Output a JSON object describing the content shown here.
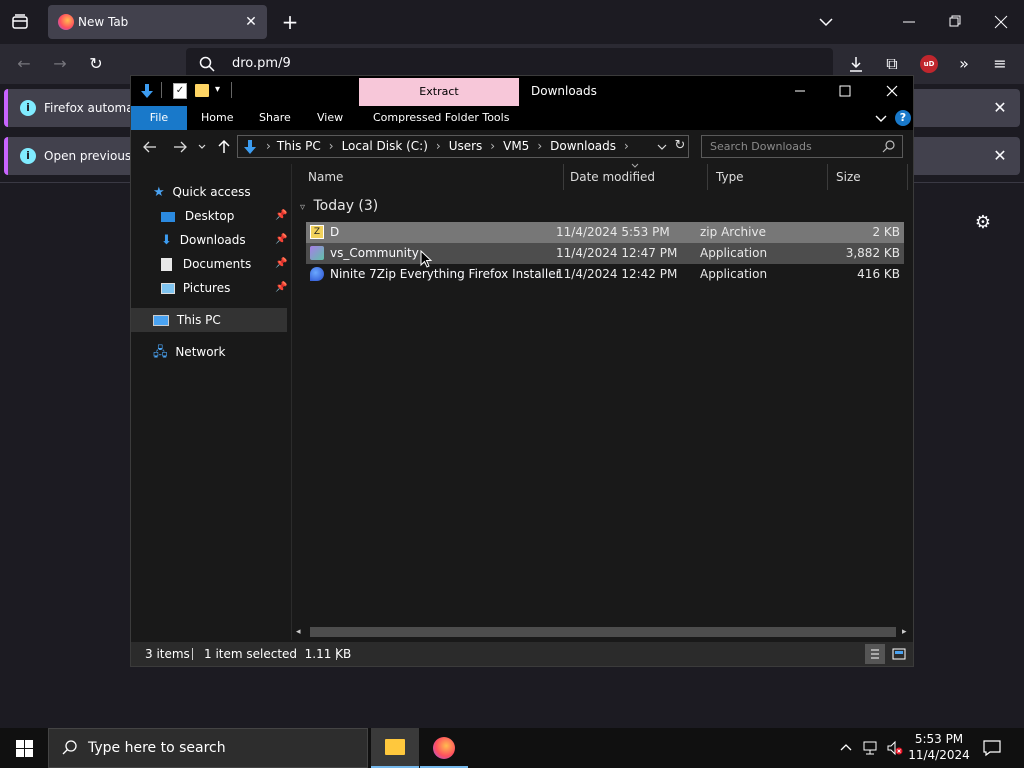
{
  "browser": {
    "tab_title": "New Tab",
    "url": "dro.pm/9",
    "notification_1": "Firefox automatic",
    "notification_2": "Open previous ta"
  },
  "explorer": {
    "window_title": "Downloads",
    "context_tab_header": "Extract",
    "ribbon_tabs": [
      "File",
      "Home",
      "Share",
      "View",
      "Compressed Folder Tools"
    ],
    "breadcrumb": [
      "This PC",
      "Local Disk (C:)",
      "Users",
      "VM5",
      "Downloads"
    ],
    "search_placeholder": "Search Downloads",
    "nav": {
      "quick_access": "Quick access",
      "desktop": "Desktop",
      "downloads": "Downloads",
      "documents": "Documents",
      "pictures": "Pictures",
      "this_pc": "This PC",
      "network": "Network"
    },
    "columns": {
      "name": "Name",
      "date": "Date modified",
      "type": "Type",
      "size": "Size"
    },
    "group_label": "Today (3)",
    "files": [
      {
        "name": "D",
        "date": "11/4/2024 5:53 PM",
        "type": "zip Archive",
        "size": "2 KB"
      },
      {
        "name": "vs_Community",
        "date": "11/4/2024 12:47 PM",
        "type": "Application",
        "size": "3,882 KB"
      },
      {
        "name": "Ninite 7Zip Everything Firefox Installer",
        "date": "11/4/2024 12:42 PM",
        "type": "Application",
        "size": "416 KB"
      }
    ],
    "status": {
      "items": "3 items",
      "selected": "1 item selected  1.11 KB"
    }
  },
  "taskbar": {
    "search_placeholder": "Type here to search",
    "time": "5:53 PM",
    "date": "11/4/2024"
  },
  "colors": {
    "accent": "#1979ca",
    "context_tab": "#f7c7d9",
    "firefox_accent": "#c864ff"
  }
}
